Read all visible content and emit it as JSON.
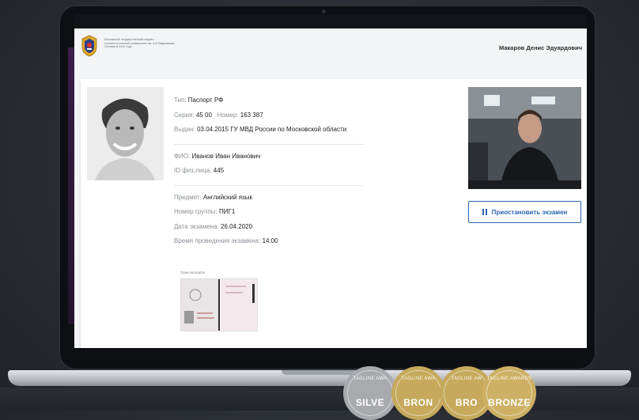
{
  "app": {
    "university_text": "Московский государственный медико-стоматологический университет им. А.И.Евдокимова Основан в 1922 году",
    "user_name": "Макаров Денис Эдуардович"
  },
  "passport": {
    "type_label": "Тип:",
    "type_value": "Паспорт РФ",
    "series_label": "Серия:",
    "series_value": "45 00",
    "number_label": "Номер:",
    "number_value": "163 387",
    "issued_label": "Выдан:",
    "issued_value": "03.04.2015 ГУ МВД России по Московской области"
  },
  "person": {
    "fio_label": "ФИО:",
    "fio_value": "Иванов Иван Иванович",
    "id_label": "ID физ.лица:",
    "id_value": "445"
  },
  "exam": {
    "subject_label": "Предмет:",
    "subject_value": "Английский язык",
    "group_label": "Номер группы:",
    "group_value": "ПИГ1",
    "date_label": "Дата экзамена:",
    "date_value": "26.04.2020",
    "time_label": "Время проведения экзамена:",
    "time_value": "14:00"
  },
  "scan": {
    "title": "Скан паспорта"
  },
  "actions": {
    "pause_label": "Приостановить экзамен"
  },
  "badges": [
    {
      "top": "TAGLINE AWA",
      "label": "SILVE",
      "color": "#a9aaad"
    },
    {
      "top": "TAGLINE AWA",
      "label": "BRON",
      "color": "#c6a95c"
    },
    {
      "top": "TAGLINE AW",
      "label": "BRO",
      "color": "#c6a95c"
    },
    {
      "top": "TAGLINE AWARDS",
      "label": "BRONZE",
      "color": "#cdb064"
    }
  ],
  "colors": {
    "accent": "#2f66b3"
  }
}
